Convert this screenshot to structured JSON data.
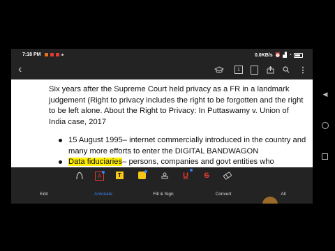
{
  "status": {
    "time": "7:18 PM",
    "speed": "0.0KB/s",
    "notification_colors": [
      "#e8711d",
      "#e53935",
      "#e53935"
    ]
  },
  "toolbar": {
    "page_indicator": "1"
  },
  "document": {
    "paragraph": "Six years after the Supreme Court held privacy as a FR in a landmark judgement (Right to privacy includes the right to be forgotten and the right to be left alone. About the Right to Privacy: In Puttaswamy v. Union of India case, 2017",
    "bullets": [
      {
        "highlight": "",
        "text": "15 August 1995– internet commercially introduced in the country and many more efforts to enter the DIGITAL BANDWAGON"
      },
      {
        "highlight": "Data fiduciaries",
        "text": "– persons, companies and govt entities who"
      }
    ],
    "highlight_color": "#ffee00"
  },
  "annotate_tools": [
    "pen-tool",
    "text-box-tool",
    "text-tool",
    "highlighter-tool",
    "stamp-tool",
    "underline-tool",
    "strikethrough-tool",
    "eraser-tool"
  ],
  "tabs": {
    "edit": "Edit",
    "annotate": "Annotate",
    "fill_sign": "Fill & Sign",
    "convert": "Convert",
    "all": "All"
  },
  "colors": {
    "accent": "#3b82f6",
    "app_bg": "#232323",
    "highlighter": "#f5c518"
  }
}
